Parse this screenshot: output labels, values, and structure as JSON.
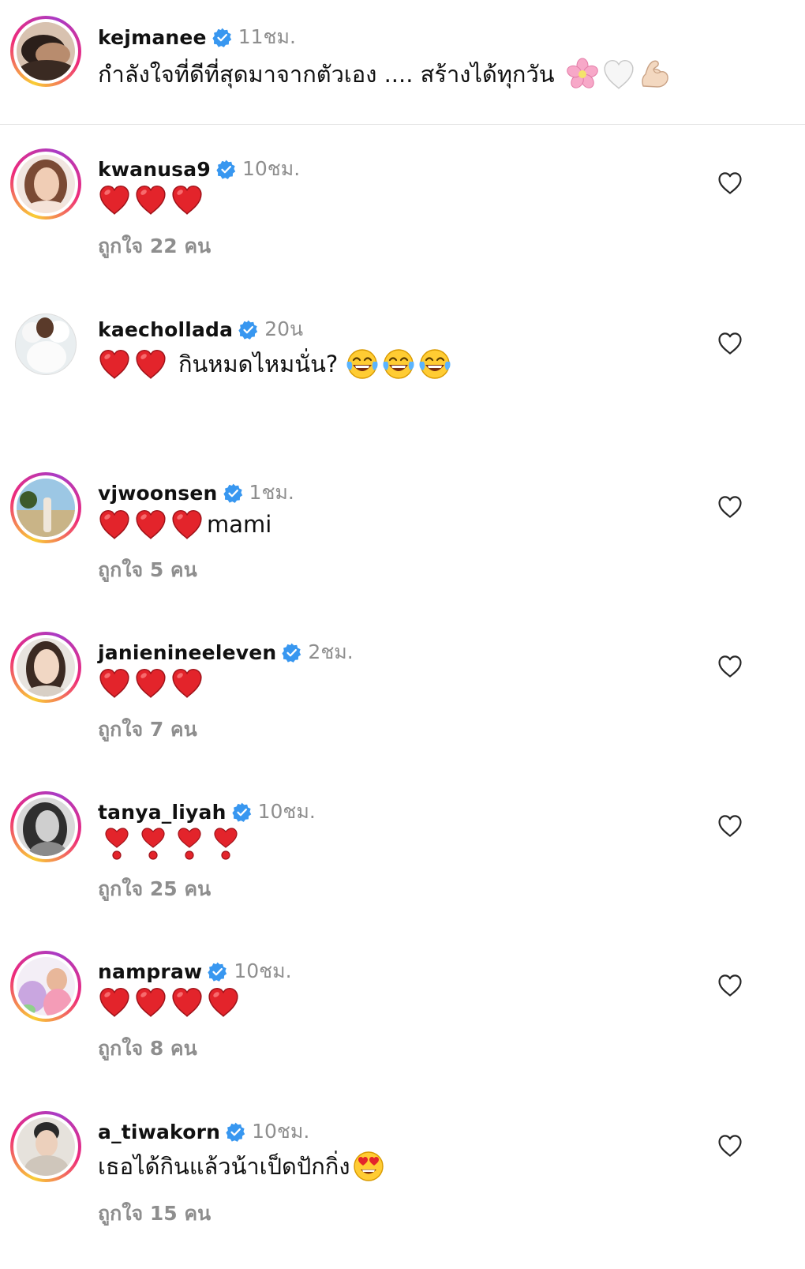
{
  "caption": {
    "username": "kejmanee",
    "time": "11ชม.",
    "text": "กำลังใจที่ดีที่สุดมาจากตัวเอง .... สร้างได้ทุกวัน",
    "emojis": [
      "cherry-blossom",
      "white-heart",
      "flexed-biceps"
    ]
  },
  "comments": [
    {
      "username": "kwanusa9",
      "time": "10ชม.",
      "hearts": 3,
      "likes": "ถูกใจ 22 คน"
    },
    {
      "username": "kaechollada",
      "time": "20น",
      "hearts": 2,
      "text": "กินหมดไหมนั่น?",
      "trailing_emojis": [
        "face-with-tears-of-joy",
        "face-with-tears-of-joy",
        "face-with-tears-of-joy"
      ]
    },
    {
      "username": "vjwoonsen",
      "time": "1ชม.",
      "hearts": 3,
      "text": "mami",
      "likes": "ถูกใจ 5 คน"
    },
    {
      "username": "janienineeleven",
      "time": "2ชม.",
      "hearts": 3,
      "likes": "ถูกใจ 7 คน"
    },
    {
      "username": "tanya_liyah",
      "time": "10ชม.",
      "heart_exclamations": 4,
      "likes": "ถูกใจ 25 คน"
    },
    {
      "username": "nampraw",
      "time": "10ชม.",
      "hearts": 4,
      "likes": "ถูกใจ 8 คน"
    },
    {
      "username": "a_tiwakorn",
      "time": "10ชม.",
      "text": "เธอได้กินแล้วน้าเป็ดปักกิ่ง",
      "trailing_emojis": [
        "smiling-face-with-heart-eyes"
      ],
      "likes": "ถูกใจ 15 คน"
    }
  ],
  "icons": {
    "verified_badge": "verified-badge-icon",
    "like": "heart-outline-icon",
    "badge_color": "#3897f0",
    "heart_color": "#e0245e",
    "muted_text_color": "#8e8e8e"
  }
}
